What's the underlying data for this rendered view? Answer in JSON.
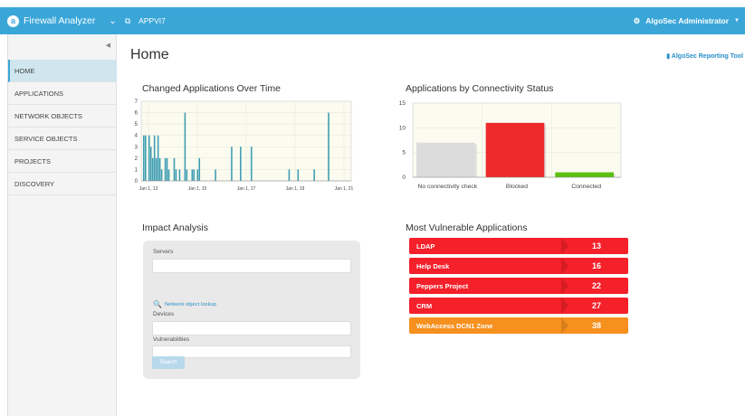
{
  "topbar": {
    "product": "Firewall Analyzer",
    "app_name": "APPVI7",
    "user": "AlgoSec Administrator"
  },
  "sidebar": {
    "items": [
      {
        "label": "HOME",
        "active": true
      },
      {
        "label": "APPLICATIONS",
        "active": false
      },
      {
        "label": "NETWORK OBJECTS",
        "active": false
      },
      {
        "label": "SERVICE OBJECTS",
        "active": false
      },
      {
        "label": "PROJECTS",
        "active": false
      },
      {
        "label": "DISCOVERY",
        "active": false
      }
    ]
  },
  "main": {
    "title": "Home",
    "report_link": "AlgoSec Reporting Tool"
  },
  "impact": {
    "title": "Impact Analysis",
    "servers_label": "Servers",
    "lookup_link": "Network object lookup",
    "devices_label": "Devices",
    "vulns_label": "Vulnerabilities",
    "search_label": "Search"
  },
  "vulnerable": {
    "title": "Most Vulnerable Applications",
    "items": [
      {
        "name": "LDAP",
        "count": "13",
        "color": "#f4202a"
      },
      {
        "name": "Help Desk",
        "count": "16",
        "color": "#f4202a"
      },
      {
        "name": "Peppers Project",
        "count": "22",
        "color": "#f4202a"
      },
      {
        "name": "CRM",
        "count": "27",
        "color": "#f4202a"
      },
      {
        "name": "WebAccess  DCN1 Zone",
        "count": "38",
        "color": "#f6901e"
      }
    ]
  },
  "chart_data": [
    {
      "type": "bar",
      "title": "Changed Applications Over Time",
      "ylim": [
        0,
        7
      ],
      "yticks": [
        0,
        1,
        2,
        3,
        4,
        5,
        6,
        7
      ],
      "xticks": [
        "Jan 1, 13",
        "Jan 1, 15",
        "Jan 1, 17",
        "Jan 1, 19",
        "Jan 1, 21"
      ],
      "color": "#3f9db3",
      "values": [
        0,
        4,
        4,
        0,
        4,
        3,
        2,
        4,
        2,
        4,
        2,
        1,
        0,
        2,
        2,
        1,
        0,
        0,
        2,
        1,
        0,
        1,
        0,
        0,
        6,
        1,
        0,
        0,
        1,
        1,
        0,
        1,
        2,
        0,
        0,
        0,
        0,
        0,
        0,
        0,
        0,
        1,
        0,
        0,
        0,
        0,
        0,
        0,
        0,
        0,
        3,
        0,
        0,
        0,
        0,
        3,
        0,
        0,
        0,
        0,
        0,
        3,
        0,
        0,
        0,
        0,
        0,
        0,
        0,
        0,
        0,
        0,
        0,
        0,
        0,
        0,
        0,
        0,
        0,
        0,
        0,
        0,
        1,
        0,
        0,
        0,
        0,
        1,
        0,
        0,
        0,
        0,
        0,
        0,
        0,
        0,
        1,
        0,
        0,
        0,
        0,
        0,
        0,
        0,
        6,
        0,
        0,
        0,
        0,
        0,
        0,
        0,
        0,
        0,
        0,
        0,
        0
      ],
      "grid": true
    },
    {
      "type": "bar",
      "title": "Applications by Connectivity Status",
      "categories": [
        "No connectivity check",
        "Blocked",
        "Connected"
      ],
      "values": [
        7,
        11,
        1
      ],
      "colors": [
        "#dcdcdc",
        "#ee2a2a",
        "#5cc012"
      ],
      "ylim": [
        0,
        15
      ],
      "yticks": [
        0,
        5,
        10,
        15
      ],
      "grid": true
    }
  ]
}
